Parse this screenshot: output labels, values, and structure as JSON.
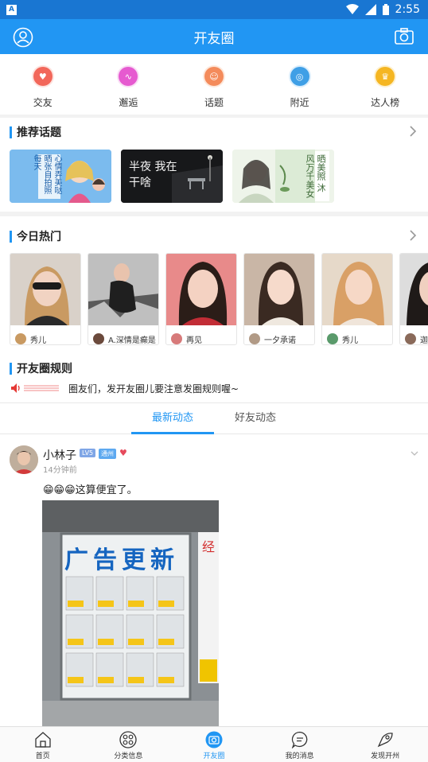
{
  "status": {
    "time": "2:55",
    "notif_icon": "A"
  },
  "header": {
    "title": "开友圈"
  },
  "quick": [
    {
      "label": "交友",
      "icon": "heart-icon",
      "color": "#f2675a"
    },
    {
      "label": "邂逅",
      "icon": "pulse-icon",
      "color": "#e65ad0"
    },
    {
      "label": "话题",
      "icon": "chat-icon",
      "color": "#f48b5b"
    },
    {
      "label": "附近",
      "icon": "location-icon",
      "color": "#3f9fe6"
    },
    {
      "label": "达人榜",
      "icon": "crown-icon",
      "color": "#f5b622"
    }
  ],
  "sections": {
    "topics": "推荐话题",
    "hot": "今日热门",
    "rules": "开友圈规则"
  },
  "topics": [
    {
      "text": "心情弄美哒 晒张自拍照 每天"
    },
    {
      "text": "半夜 我在干啥"
    },
    {
      "text": "晒美照 沐风万千美女"
    }
  ],
  "hot": [
    {
      "name": "秀儿"
    },
    {
      "name": "A.深情是癫是"
    },
    {
      "name": "再见"
    },
    {
      "name": "一夕承诺"
    },
    {
      "name": "秀儿"
    },
    {
      "name": "迦"
    }
  ],
  "rule_text": "圈友们，发开友圈儿要注意发圈规则喔~",
  "tabs": [
    "最新动态",
    "好友动态"
  ],
  "post": {
    "name": "小林子",
    "level": "LV5",
    "tag": "通州",
    "time": "14分钟前",
    "text": "😁😁😁这算便宜了。",
    "sign_title": "广告更新"
  },
  "nav": [
    {
      "label": "首页"
    },
    {
      "label": "分类信息"
    },
    {
      "label": "开友圈"
    },
    {
      "label": "我的消息"
    },
    {
      "label": "发现开州"
    }
  ],
  "colors": {
    "primary": "#2196f3",
    "statusbar": "#1976d2"
  }
}
